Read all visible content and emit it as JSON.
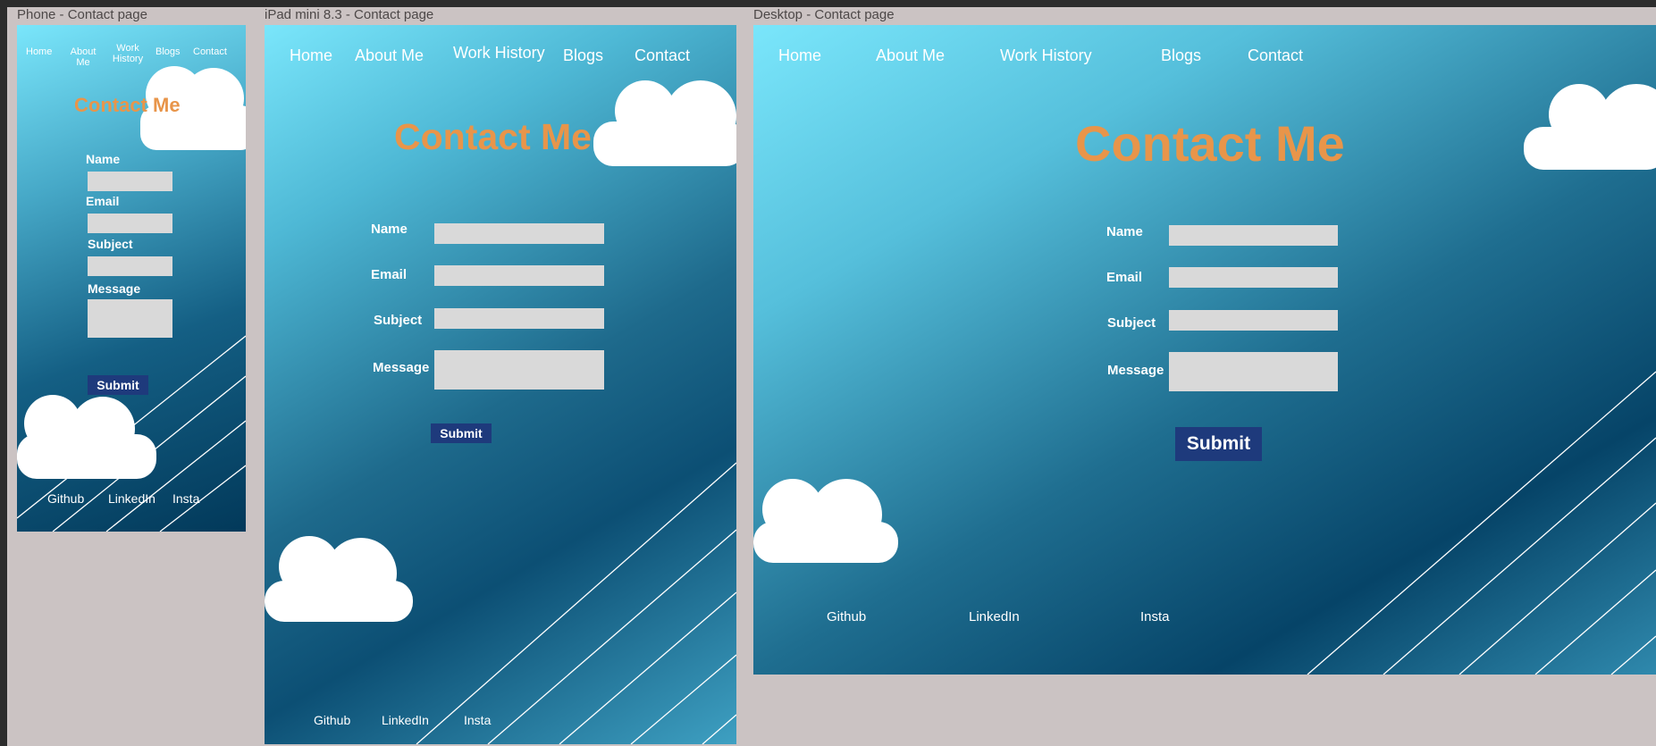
{
  "frames": {
    "phone": {
      "title": "Phone - Contact page",
      "nav": [
        "Home",
        "About Me",
        "Work History",
        "Blogs",
        "Contact"
      ],
      "heading": "Contact Me",
      "form": {
        "name_label": "Name",
        "email_label": "Email",
        "subject_label": "Subject",
        "message_label": "Message",
        "submit_label": "Submit"
      },
      "footer": [
        "Github",
        "LinkedIn",
        "Insta"
      ]
    },
    "ipad": {
      "title": "iPad mini 8.3 - Contact page",
      "nav": [
        "Home",
        "About Me",
        "Work History",
        "Blogs",
        "Contact"
      ],
      "heading": "Contact Me",
      "form": {
        "name_label": "Name",
        "email_label": "Email",
        "subject_label": "Subject",
        "message_label": "Message",
        "submit_label": "Submit"
      },
      "footer": [
        "Github",
        "LinkedIn",
        "Insta"
      ]
    },
    "desktop": {
      "title": "Desktop - Contact page",
      "nav": [
        "Home",
        "About Me",
        "Work History",
        "Blogs",
        "Contact"
      ],
      "heading": "Contact Me",
      "form": {
        "name_label": "Name",
        "email_label": "Email",
        "subject_label": "Subject",
        "message_label": "Message",
        "submit_label": "Submit"
      },
      "footer": [
        "Github",
        "LinkedIn",
        "Insta"
      ]
    }
  },
  "colors": {
    "heading": "#e8954a",
    "field": "#d9d9d9",
    "submit": "#1e3a7c",
    "canvas": "#cbc3c3",
    "gradient_top": "#7ae6fb",
    "gradient_bottom": "#02395a"
  },
  "icons": {
    "cloud": "cloud-icon",
    "stripes": "diagonal-lines-decoration"
  }
}
